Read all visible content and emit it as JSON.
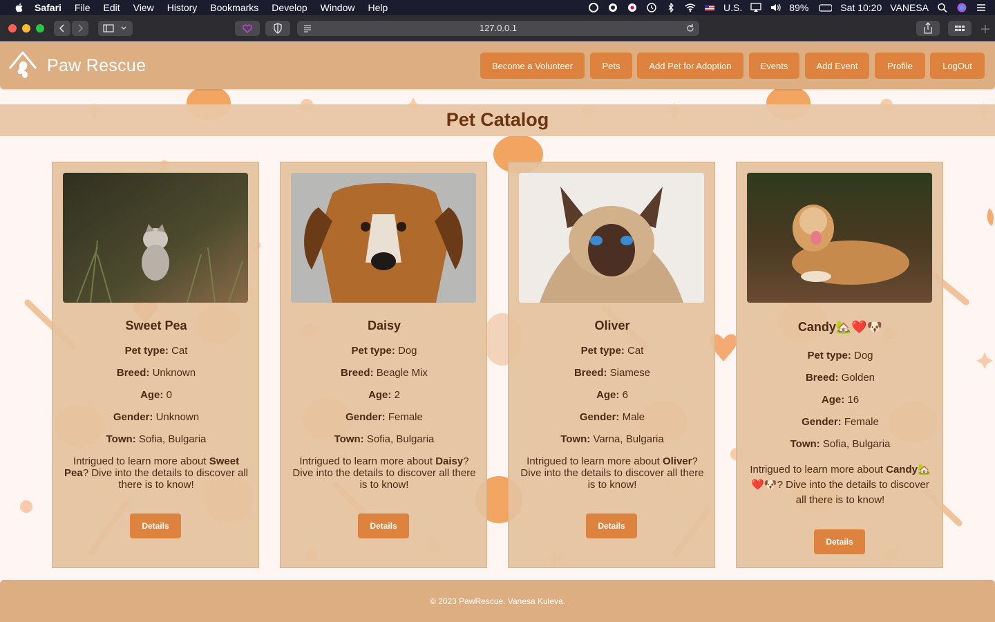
{
  "menubar": {
    "app_name": "Safari",
    "items": [
      "File",
      "Edit",
      "View",
      "History",
      "Bookmarks",
      "Develop",
      "Window",
      "Help"
    ],
    "input_source": "U.S.",
    "battery": "89%",
    "clock": "Sat 10:20",
    "user": "VANESA"
  },
  "browser": {
    "url": "127.0.0.1"
  },
  "site": {
    "logo_text": "Paw Rescue",
    "nav": [
      "Become a Volunteer",
      "Pets",
      "Add Pet for Adoption",
      "Events",
      "Add Event",
      "Profile",
      "LogOut"
    ],
    "page_title": "Pet Catalog"
  },
  "labels": {
    "pet_type": "Pet type:",
    "breed": "Breed:",
    "age": "Age:",
    "gender": "Gender:",
    "town": "Town:",
    "desc_prefix": "Intrigued to learn more about ",
    "desc_suffix": "? Dive into the details to discover all there is to know!",
    "details_button": "Details"
  },
  "pets": [
    {
      "name": "Sweet Pea",
      "pet_type": "Cat",
      "breed": "Unknown",
      "age": "0",
      "gender": "Unknown",
      "town": "Sofia, Bulgaria",
      "image": "kitten-in-grass-photo"
    },
    {
      "name": "Daisy",
      "pet_type": "Dog",
      "breed": "Beagle Mix",
      "age": "2",
      "gender": "Female",
      "town": "Sofia, Bulgaria",
      "image": "beagle-mix-dog-photo"
    },
    {
      "name": "Oliver",
      "pet_type": "Cat",
      "breed": "Siamese",
      "age": "6",
      "gender": "Male",
      "town": "Varna, Bulgaria",
      "image": "siamese-cat-photo"
    },
    {
      "name": "Candy🏡❤️🐶",
      "pet_type": "Dog",
      "breed": "Golden",
      "age": "16",
      "gender": "Female",
      "town": "Sofia, Bulgaria",
      "image": "golden-retriever-photo"
    }
  ],
  "footer": {
    "text": "© 2023 PawRescue. Vanesa Kuleva."
  },
  "colors": {
    "header": "#ddae82",
    "nav_button": "#dd823f",
    "card": "#e5c29e",
    "title_text": "#6a3410",
    "page_bg": "#fff6f3"
  }
}
